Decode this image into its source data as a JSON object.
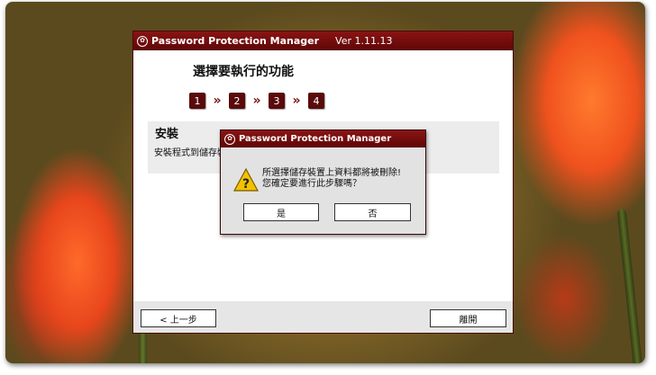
{
  "window": {
    "title": "Password Protection Manager",
    "version": "Ver 1.11.13"
  },
  "wizard": {
    "heading": "選擇要執行的功能",
    "steps": [
      "1",
      "2",
      "3",
      "4"
    ],
    "step_separator": "»",
    "panel_title": "安裝",
    "panel_desc": "安裝程式到儲存裝"
  },
  "footer": {
    "back_label": "< 上一步",
    "close_label": "離開"
  },
  "dialog": {
    "title": "Password Protection Manager",
    "message_line1": "所選擇儲存裝置上資料都將被刪除!",
    "message_line2": "您確定要進行此步驟嗎？",
    "yes_label": "是",
    "no_label": "否"
  },
  "colors": {
    "title_bar": "#6e0c0c",
    "step_badge": "#5a0a0a",
    "warning": "#f2c200"
  }
}
